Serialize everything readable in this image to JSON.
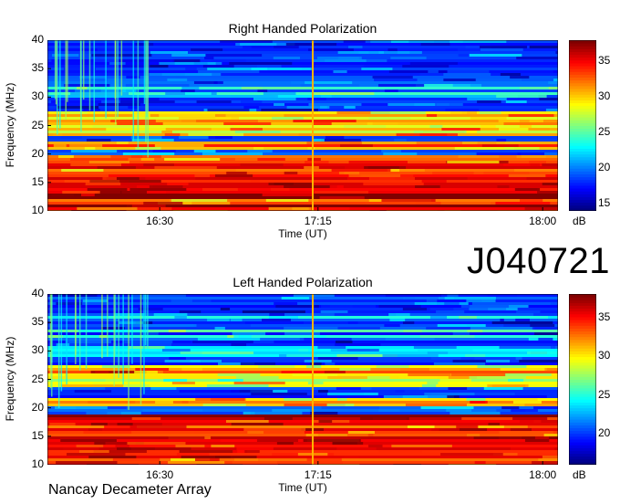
{
  "chart_data": [
    {
      "type": "heatmap",
      "title": "Right Handed Polarization",
      "xlabel": "Time (UT)",
      "ylabel": "Frequency (MHz)",
      "x_tick_labels": [
        "16:30",
        "17:15",
        "18:00"
      ],
      "y_tick_labels": [
        "10",
        "15",
        "20",
        "25",
        "30",
        "35",
        "40"
      ],
      "ylim": [
        10,
        40
      ],
      "colorbar": {
        "label": "dB",
        "ticks": [
          "15",
          "20",
          "25",
          "30",
          "35"
        ],
        "range": [
          14,
          38
        ]
      },
      "bright_bands_mhz": [
        {
          "low": 10.0,
          "high": 20.0,
          "level_db": 35
        },
        {
          "low": 21.0,
          "high": 22.5,
          "level_db": 33
        },
        {
          "low": 23.5,
          "high": 27.5,
          "level_db": 30
        },
        {
          "low": 30.0,
          "high": 31.0,
          "level_db": 24
        }
      ]
    },
    {
      "type": "heatmap",
      "title": "Left Handed Polarization",
      "xlabel": "Time (UT)",
      "ylabel": "Frequency (MHz)",
      "x_tick_labels": [
        "16:30",
        "17:15",
        "18:00"
      ],
      "y_tick_labels": [
        "10",
        "15",
        "20",
        "25",
        "30",
        "35",
        "40"
      ],
      "ylim": [
        10,
        40
      ],
      "colorbar": {
        "label": "dB",
        "ticks": [
          "20",
          "25",
          "30",
          "35"
        ],
        "range": [
          16,
          38
        ]
      },
      "bright_bands_mhz": [
        {
          "low": 10.0,
          "high": 19.0,
          "level_db": 35
        },
        {
          "low": 20.5,
          "high": 22.0,
          "level_db": 32
        },
        {
          "low": 24.0,
          "high": 27.5,
          "level_db": 30
        },
        {
          "low": 29.5,
          "high": 31.0,
          "level_db": 24
        }
      ]
    }
  ],
  "dataset_id": "J040721",
  "footer": "Nancay Decameter Array"
}
